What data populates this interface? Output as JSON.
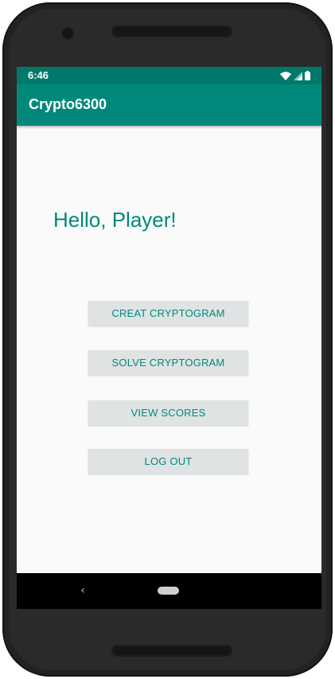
{
  "status_bar": {
    "time": "6:46",
    "icons": [
      "wifi-icon",
      "cell-signal-icon",
      "battery-icon"
    ]
  },
  "app_bar": {
    "title": "Crypto6300"
  },
  "main": {
    "greeting": "Hello, Player!",
    "buttons": [
      {
        "label": "CREAT CRYPTOGRAM"
      },
      {
        "label": "SOLVE CRYPTOGRAM"
      },
      {
        "label": "VIEW SCORES"
      },
      {
        "label": "LOG OUT"
      }
    ]
  },
  "nav_bar": {
    "back_icon": "‹",
    "icons": [
      "back-icon",
      "home-icon"
    ]
  },
  "colors": {
    "primary": "#00897b",
    "primary_dark": "#00796b",
    "button_bg": "#dfe3e3",
    "background": "#fafafa"
  }
}
